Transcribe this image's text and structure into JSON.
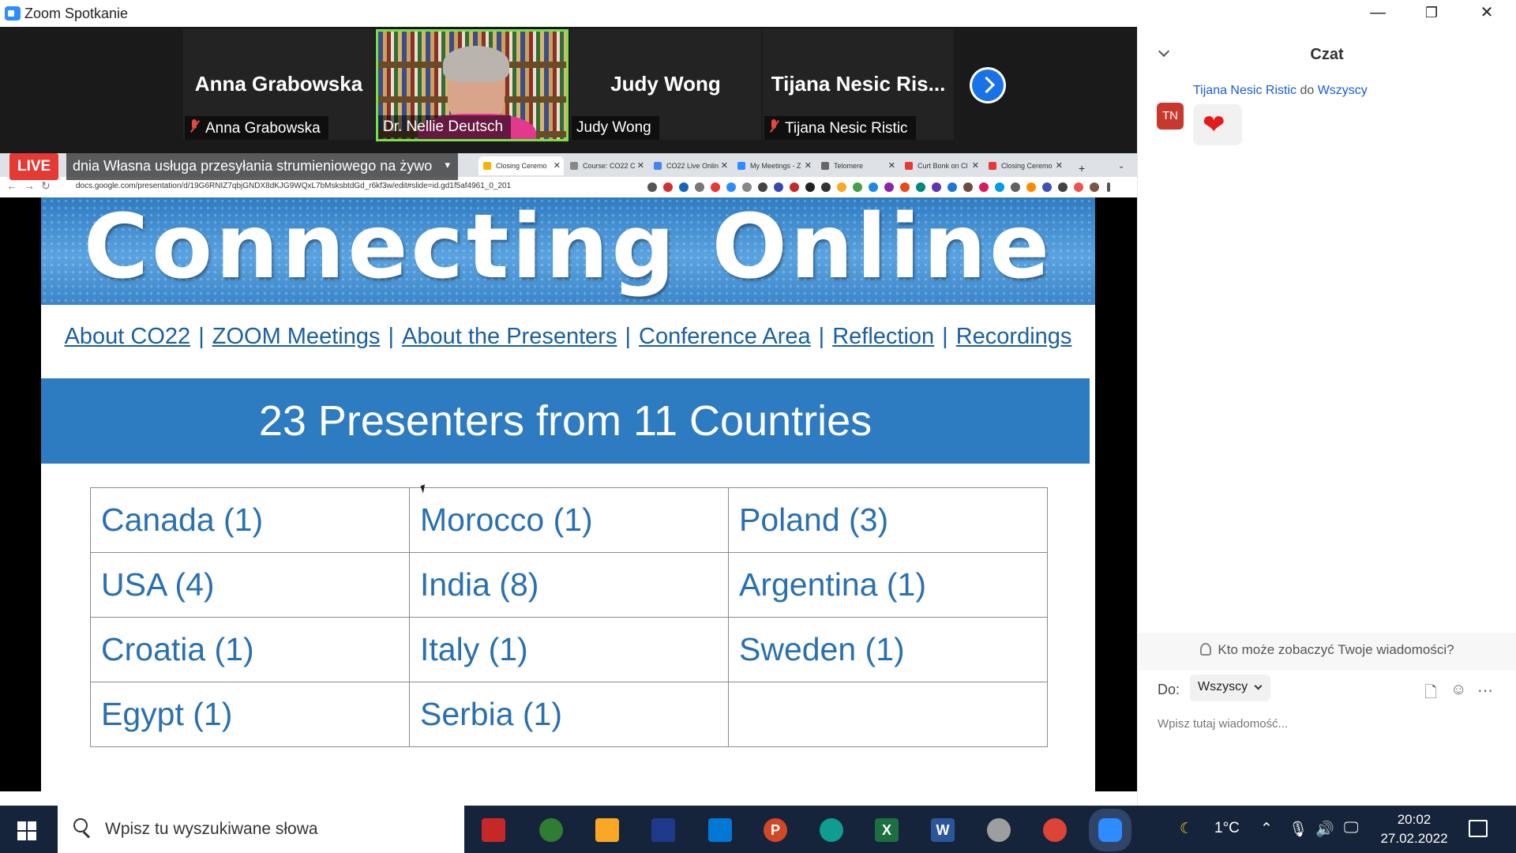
{
  "window": {
    "title": "Zoom Spotkanie",
    "controls": [
      "—",
      "❐",
      "✕"
    ]
  },
  "strip": {
    "tiles": [
      {
        "big_name": "Anna Grabowska",
        "caption": "Anna Grabowska",
        "muted": true
      },
      {
        "caption": "Dr. Nellie Deutsch",
        "muted": false,
        "active_speaker": true
      },
      {
        "big_name": "Judy Wong",
        "caption": "Judy Wong",
        "muted": false
      },
      {
        "big_name": "Tijana Nesic Ris...",
        "caption": "Tijana Nesic Ristic",
        "muted": true
      }
    ]
  },
  "live": {
    "badge": "LIVE",
    "banner": "dnia Własna usługa przesyłania strumieniowego na żywo"
  },
  "browser": {
    "tabs": [
      "Closing Ceremo",
      "Course: CO22 C",
      "CO22 Live Onlin",
      "My Meetings - Z",
      "Telomere",
      "Curt Bonk on Cl",
      "Closing Ceremo"
    ],
    "url": "docs.google.com/presentation/d/19G6RNIZ7qbjGNDX8dKJG9WQxL7bMsksbtdGd_r6kf3w/edit#slide=id.gd1f5af4961_0_201"
  },
  "slide": {
    "banner_title": "Connecting Online",
    "nav_links": [
      "About CO22",
      "ZOOM Meetings",
      "About the Presenters",
      "Conference Area",
      "Reflection",
      "Recordings"
    ],
    "separator": "|",
    "headline": "23 Presenters from 11 Countries",
    "table": [
      [
        "Canada (1)",
        "Morocco (1)",
        "Poland (3)"
      ],
      [
        "USA (4)",
        "India (8)",
        "Argentina (1)"
      ],
      [
        "Croatia (1)",
        "Italy (1)",
        "Sweden (1)"
      ],
      [
        "Egypt (1)",
        "Serbia (1)",
        ""
      ]
    ]
  },
  "chat": {
    "title": "Czat",
    "avatar": "TN",
    "message": {
      "sender": "Tijana Nesic Ristic",
      "to_word": "do",
      "recipient": "Wszyscy",
      "reaction": "❤"
    },
    "who_can_see": "Kto może zobaczyć Twoje wiadomości?",
    "to_label": "Do:",
    "recipient_select": "Wszyscy",
    "input_placeholder": "Wpisz tutaj wiadomość..."
  },
  "taskbar": {
    "search_placeholder": "Wpisz tu wyszukiwane słowa",
    "weather": "1°C",
    "time": "20:02",
    "date": "27.02.2022"
  }
}
